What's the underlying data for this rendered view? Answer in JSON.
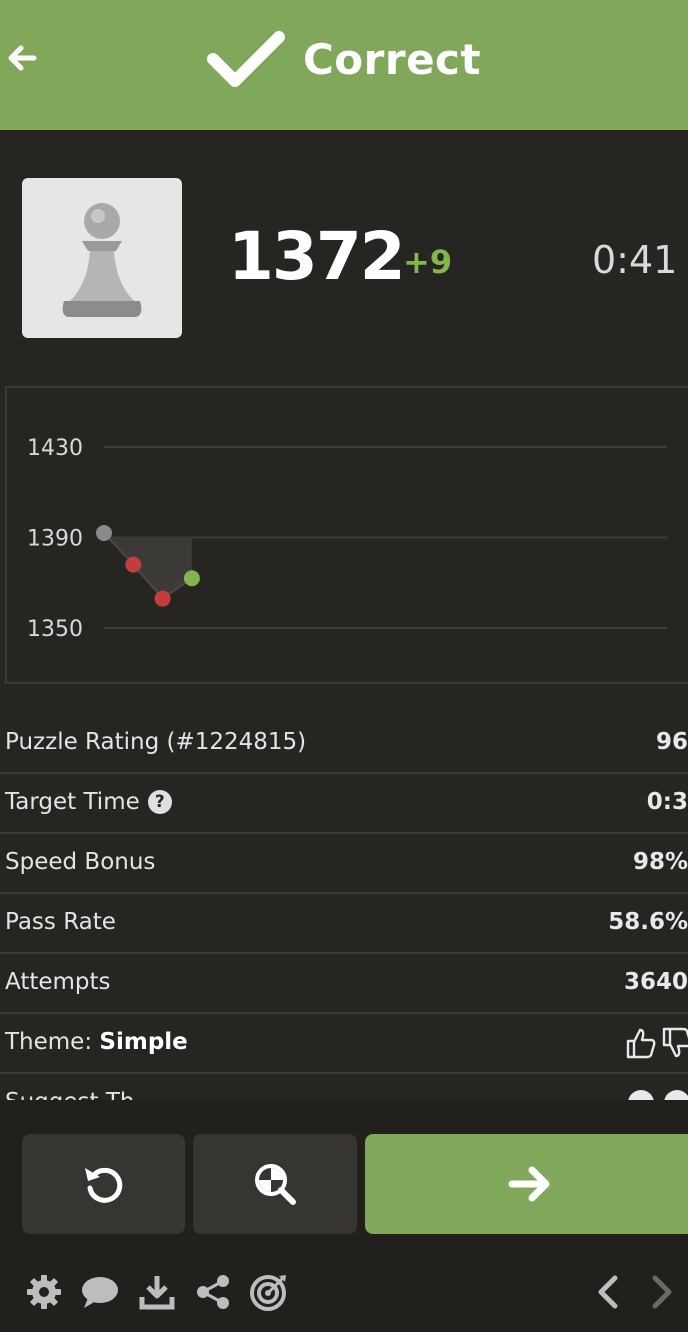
{
  "header": {
    "title": "Correct",
    "back_icon": "arrow-left-icon",
    "check_icon": "checkmark-icon",
    "background": "#81a75a"
  },
  "rating": {
    "value": "1372",
    "delta": "+9",
    "timer": "0:41",
    "avatar_icon": "pawn-icon"
  },
  "chart_data": {
    "type": "line",
    "y_ticks": [
      "1430",
      "1390",
      "1350"
    ],
    "ylim": [
      1340,
      1440
    ],
    "grid": true,
    "x": [
      1,
      2,
      3,
      4
    ],
    "values": [
      1392,
      1378,
      1363,
      1372
    ],
    "point_colors": [
      "#8b8b8b",
      "#c43d3d",
      "#c43d3d",
      "#81b64c"
    ],
    "fill_baseline": 1390
  },
  "stats": {
    "rows": [
      {
        "label": "Puzzle Rating (#1224815)",
        "value": "96"
      },
      {
        "label": "Target Time",
        "value": "0:3"
      },
      {
        "label": "Speed Bonus",
        "value": "98%"
      },
      {
        "label": "Pass Rate",
        "value": "58.6%"
      },
      {
        "label": "Attempts",
        "value": "3640"
      }
    ],
    "theme_prefix": "Theme: ",
    "theme_value": "Simple",
    "partial_label": "Suggest Th"
  },
  "actions": {
    "retry_icon": "retry-icon",
    "analyze_icon": "analysis-magnifier-icon",
    "next_icon": "arrow-right-icon",
    "next_color": "#81a75a"
  },
  "toolbar": {
    "icons": [
      "gear-icon",
      "chat-icon",
      "download-icon",
      "share-icon",
      "target-icon",
      "chevron-left-icon",
      "chevron-right-icon"
    ]
  }
}
